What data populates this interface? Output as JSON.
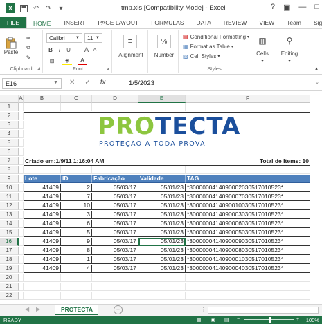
{
  "window": {
    "title": "tmp.xls  [Compatibility Mode] - Excel",
    "help": "?",
    "minimize": "—",
    "restore": "□"
  },
  "ribbon_tabs": [
    "FILE",
    "HOME",
    "INSERT",
    "PAGE LAYOUT",
    "FORMULAS",
    "DATA",
    "REVIEW",
    "VIEW",
    "Team",
    "Sig"
  ],
  "ribbon": {
    "paste_label": "Paste",
    "clipboard_label": "Clipboard",
    "font_name": "Calibri",
    "font_size": "11",
    "bold": "B",
    "italic": "I",
    "underline": "U",
    "grow_font": "A",
    "shrink_font": "A",
    "font_label": "Font",
    "alignment_label": "Alignment",
    "number_label": "Number",
    "number_symbol": "%",
    "conditional_formatting": "Conditional Formatting",
    "format_as_table": "Format as Table",
    "cell_styles": "Cell Styles",
    "styles_label": "Styles",
    "cells_label": "Cells",
    "editing_label": "Editing"
  },
  "formula_bar": {
    "name_box": "E16",
    "fx": "fx",
    "value": "1/5/2023"
  },
  "columns": [
    "A",
    "B",
    "C",
    "D",
    "E",
    "F"
  ],
  "rows": [
    "1",
    "2",
    "3",
    "4",
    "5",
    "6",
    "7",
    "8",
    "9",
    "10",
    "11",
    "12",
    "13",
    "14",
    "15",
    "16",
    "17",
    "18",
    "19",
    "20",
    "21",
    "22"
  ],
  "logo": {
    "pro": "PRO",
    "tecta": "TECTA",
    "tagline": "PROTEÇÃO A TODA PROVA"
  },
  "report": {
    "created": "Criado em:1/9/11 1:16:04 AM",
    "total": "Total de Items: 10"
  },
  "table": {
    "headers": [
      "Lote",
      "ID",
      "Fabricação",
      "Validade",
      "TAG"
    ],
    "rows": [
      [
        "41409",
        "2",
        "05/03/17",
        "05/01/23",
        "*300000041409000203051701052​3*"
      ],
      [
        "41409",
        "7",
        "05/03/17",
        "05/01/23",
        "*300000041409000703051701052​3*"
      ],
      [
        "41409",
        "10",
        "05/03/17",
        "05/01/23",
        "*300000041409001003051701052​3*"
      ],
      [
        "41409",
        "3",
        "05/03/17",
        "05/01/23",
        "*300000041409000303051701052​3*"
      ],
      [
        "41409",
        "6",
        "05/03/17",
        "05/01/23",
        "*300000041409000603051701052​3*"
      ],
      [
        "41409",
        "5",
        "05/03/17",
        "05/01/23",
        "*300000041409000503051701052​3*"
      ],
      [
        "41409",
        "9",
        "05/03/17",
        "05/01/23",
        "*300000041409000903051701052​3*"
      ],
      [
        "41409",
        "8",
        "05/03/17",
        "05/01/23",
        "*300000041409000803051701052​3*"
      ],
      [
        "41409",
        "1",
        "05/03/17",
        "05/01/23",
        "*300000041409000103051701052​3*"
      ],
      [
        "41409",
        "4",
        "05/03/17",
        "05/01/23",
        "*300000041409000403051701052​3*"
      ]
    ]
  },
  "sheet_tab": "PROTECTA",
  "add_sheet": "+",
  "status": {
    "ready": "READY",
    "zoom": "100%"
  },
  "colors": {
    "excel_green": "#217346",
    "header_blue": "#4f81bd",
    "logo_green": "#8dc63f",
    "logo_blue": "#1b4f9c"
  }
}
